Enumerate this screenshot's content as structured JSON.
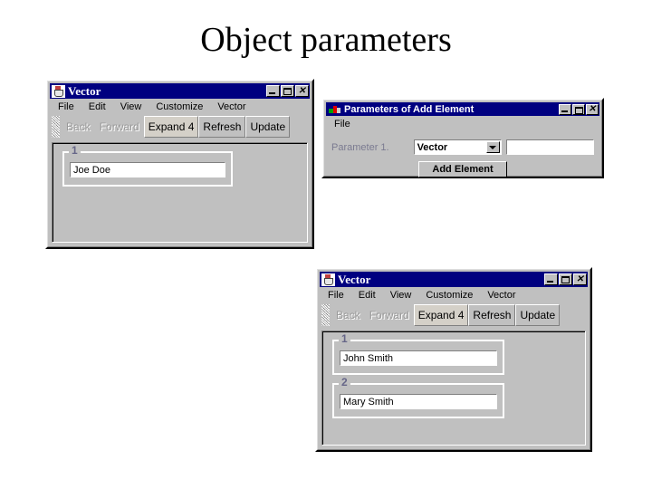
{
  "slide": {
    "title": "Object parameters"
  },
  "window_vector_1": {
    "icon": "java-cup-icon",
    "title": "Vector",
    "buttons": {
      "minimize": "_",
      "maximize": "□",
      "close": "✕"
    },
    "menu": [
      "File",
      "Edit",
      "View",
      "Customize",
      "Vector"
    ],
    "toolbar": [
      {
        "label": "Back",
        "state": "disabled"
      },
      {
        "label": "Forward",
        "state": "disabled"
      },
      {
        "label": "Expand 4",
        "state": "enabled"
      },
      {
        "label": "Refresh",
        "state": "enabled"
      },
      {
        "label": "Update",
        "state": "enabled"
      }
    ],
    "groups": [
      {
        "label": "1",
        "value": "Joe Doe"
      }
    ]
  },
  "dialog_add_element": {
    "icon": "parameters-dialog-icon",
    "title": "Parameters of Add Element",
    "buttons": {
      "minimize": "_",
      "maximize": "□",
      "close": "✕"
    },
    "menu": [
      "File"
    ],
    "parameter_label": "Parameter 1.",
    "combo_value": "Vector",
    "combo_options": [
      "Vector"
    ],
    "text_value": "",
    "text_placeholder": "",
    "add_button": "Add Element"
  },
  "window_vector_2": {
    "icon": "java-cup-icon",
    "title": "Vector",
    "buttons": {
      "minimize": "_",
      "maximize": "□",
      "close": "✕"
    },
    "menu": [
      "File",
      "Edit",
      "View",
      "Customize",
      "Vector"
    ],
    "toolbar": [
      {
        "label": "Back",
        "state": "disabled"
      },
      {
        "label": "Forward",
        "state": "disabled"
      },
      {
        "label": "Expand 4",
        "state": "enabled"
      },
      {
        "label": "Refresh",
        "state": "enabled"
      },
      {
        "label": "Update",
        "state": "enabled"
      }
    ],
    "groups": [
      {
        "label": "1",
        "value": "John Smith"
      },
      {
        "label": "2",
        "value": "Mary Smith"
      }
    ]
  },
  "colors": {
    "titlebar": "#000080",
    "face": "#c0c0c0",
    "group_label": "#666688",
    "disabled_text": "#9a9a9a",
    "field": "#ffffff"
  }
}
